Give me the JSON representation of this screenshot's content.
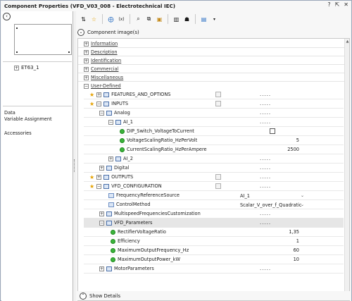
{
  "window": {
    "title": "Component Properties (VFD_V03_008 - Electrotechnical IEC)",
    "controls": [
      "?",
      "⇱",
      "✕"
    ]
  },
  "left_panel": {
    "tree_item": "ET63_1",
    "data_label": "Data",
    "variable_assignment": "Variable Assignment",
    "accessories": "Accessories"
  },
  "image_bar": {
    "label": "Component image(s)"
  },
  "categories": [
    {
      "label": "Information"
    },
    {
      "label": "Description"
    },
    {
      "label": "Identification"
    },
    {
      "label": "Commercial"
    },
    {
      "label": "Miscellaneous"
    },
    {
      "label": "User-Defined"
    }
  ],
  "rows": [
    {
      "name": "FEATURES_AND_OPTIONS",
      "value": "....."
    },
    {
      "name": "INPUTS",
      "value": "....."
    },
    {
      "name": "Analog",
      "value": "....."
    },
    {
      "name": "AI_1",
      "value": "....."
    },
    {
      "name": "DIP_Switch_VoltageToCurrent",
      "value": ""
    },
    {
      "name": "VoltageScalingRatio_HzPerVolt",
      "value": "5"
    },
    {
      "name": "CurrentScalingRatio_HzPerAmpere",
      "value": "2500"
    },
    {
      "name": "AI_2",
      "value": "....."
    },
    {
      "name": "Digital",
      "value": "....."
    },
    {
      "name": "OUTPUTS",
      "value": "....."
    },
    {
      "name": "VFD_CONFIGURATION",
      "value": "....."
    },
    {
      "name": "FrequencyReferenceSource",
      "value": "AI_1"
    },
    {
      "name": "ControlMethod",
      "value": "Scalar_V_over_f_Quadratic"
    },
    {
      "name": "MultispeedFrequenciesCustomization",
      "value": "....."
    },
    {
      "name": "VFD_Parameters",
      "value": "....."
    },
    {
      "name": "RectifierVoltageRatio",
      "value": "1,35"
    },
    {
      "name": "Efficiency",
      "value": "1"
    },
    {
      "name": "MaximumOutputFrequency_Hz",
      "value": "60"
    },
    {
      "name": "MaximumOutputPower_kW",
      "value": "10"
    },
    {
      "name": "MotorParameters",
      "value": "....."
    }
  ],
  "status": {
    "show_details": "Show Details"
  }
}
